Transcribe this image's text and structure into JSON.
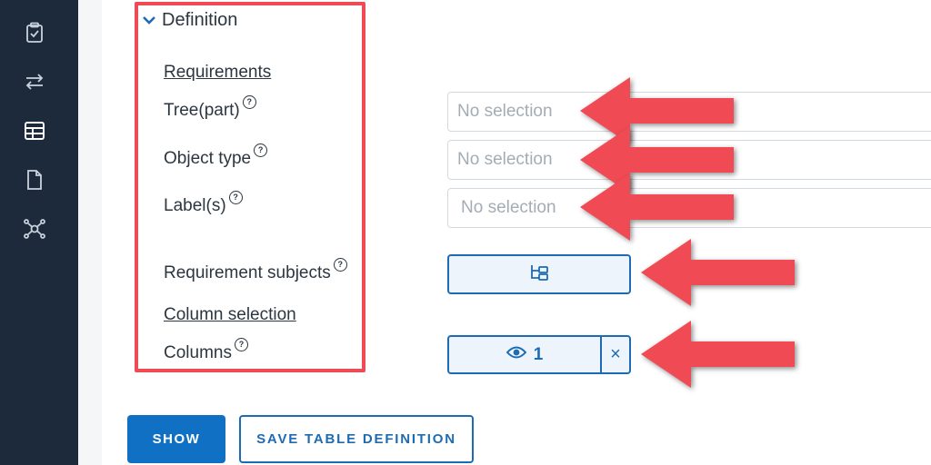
{
  "sidebar": {
    "icons": [
      "clipboard-check-icon",
      "swap-arrows-icon",
      "table-icon",
      "document-icon",
      "network-nodes-icon"
    ]
  },
  "definition": {
    "section_title": "Definition",
    "requirements_heading": "Requirements",
    "tree_label": "Tree(part)",
    "object_type_label": "Object type",
    "labels_label": "Label(s)",
    "requirement_subjects_label": "Requirement subjects",
    "column_selection_heading": "Column selection",
    "columns_label": "Columns",
    "help_glyph": "?"
  },
  "fields": {
    "tree_placeholder": "No selection",
    "object_type_placeholder": "No selection",
    "labels_placeholder": "No selection"
  },
  "columns": {
    "visible_count": "1",
    "clear_glyph": "×"
  },
  "actions": {
    "show_label": "SHOW",
    "save_label": "SAVE TABLE DEFINITION"
  },
  "colors": {
    "sidebar_bg": "#1c2a3b",
    "accent_blue": "#1070c3",
    "annotation_red": "#f04b55"
  }
}
